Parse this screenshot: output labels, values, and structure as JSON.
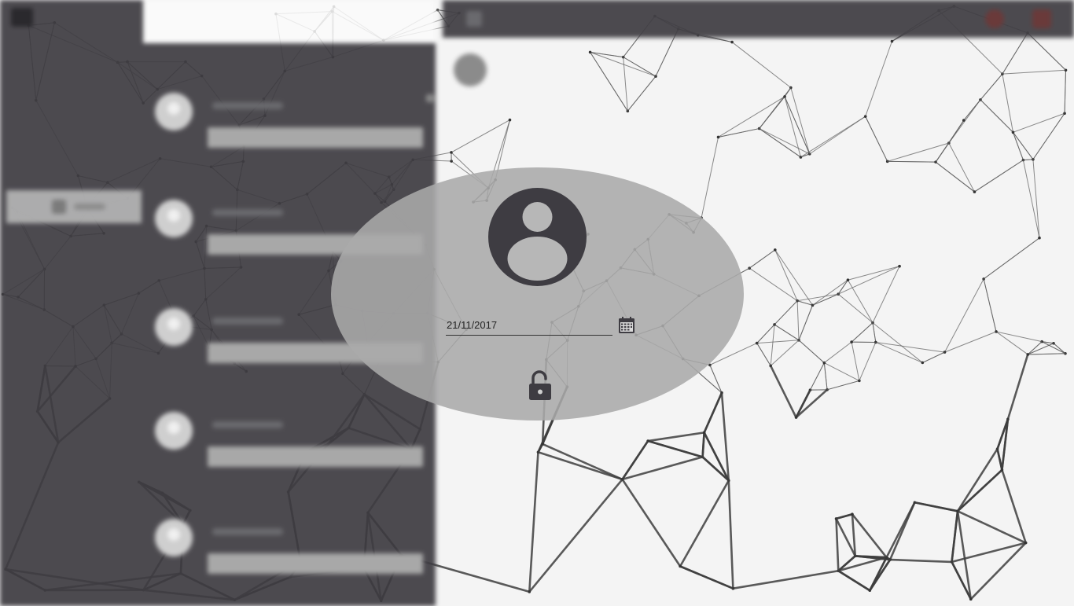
{
  "lock_screen": {
    "date_value": "21/11/2017",
    "date_placeholder": ""
  },
  "icons": {
    "avatar": "account-circle-icon",
    "calendar": "calendar-icon",
    "unlock": "lock-open-icon"
  },
  "colors": {
    "panel_dark": "#3e3c42",
    "icon_dark": "#3e3c42",
    "overlay_gray": "#aaaaaa",
    "accent_red": "#6a3a3a"
  }
}
